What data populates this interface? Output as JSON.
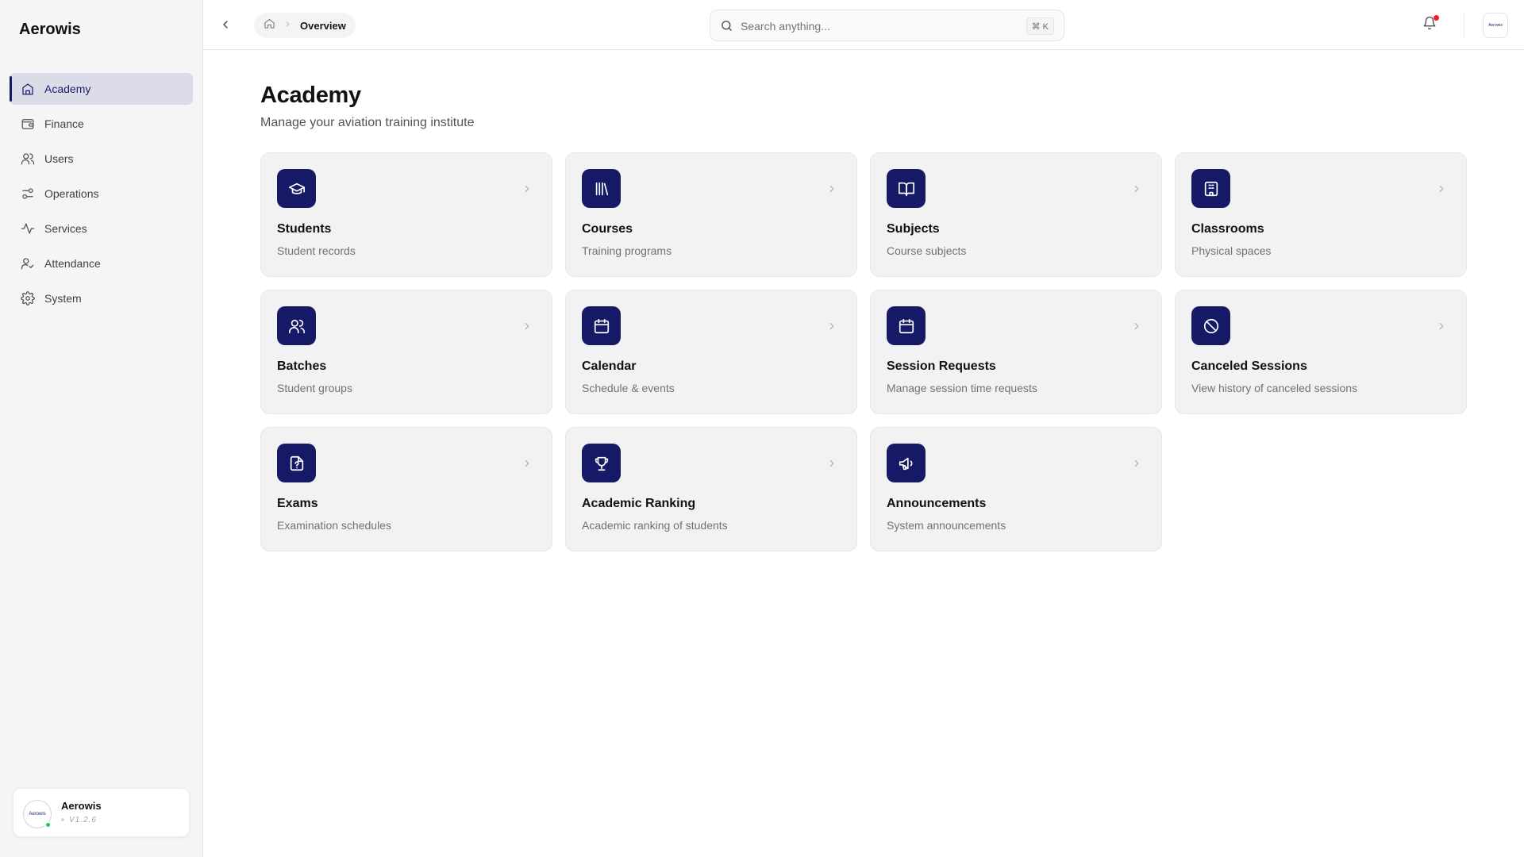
{
  "sidebar": {
    "brand": "Aerowis",
    "items": [
      {
        "label": "Academy",
        "icon": "academy-icon",
        "active": true
      },
      {
        "label": "Finance",
        "icon": "wallet-icon"
      },
      {
        "label": "Users",
        "icon": "users-icon"
      },
      {
        "label": "Operations",
        "icon": "sliders-icon"
      },
      {
        "label": "Services",
        "icon": "activity-icon"
      },
      {
        "label": "Attendance",
        "icon": "user-check-icon"
      },
      {
        "label": "System",
        "icon": "gear-icon"
      }
    ],
    "user": {
      "name": "Aerowis",
      "version": "V1.2.6",
      "avatar_text": "Aerowis",
      "status_color": "#22c55e"
    }
  },
  "header": {
    "breadcrumb": {
      "current": "Overview"
    },
    "search": {
      "placeholder": "Search anything...",
      "shortcut": "⌘ K"
    },
    "notification_badge_color": "#ef1c2b",
    "avatar_text": "Aerowis"
  },
  "main": {
    "title": "Academy",
    "subtitle": "Manage your aviation training institute",
    "cards": [
      {
        "title": "Students",
        "description": "Student records",
        "icon": "graduation-cap-icon"
      },
      {
        "title": "Courses",
        "description": "Training programs",
        "icon": "library-icon"
      },
      {
        "title": "Subjects",
        "description": "Course subjects",
        "icon": "book-open-icon"
      },
      {
        "title": "Classrooms",
        "description": "Physical spaces",
        "icon": "building-icon"
      },
      {
        "title": "Batches",
        "description": "Student groups",
        "icon": "users-icon"
      },
      {
        "title": "Calendar",
        "description": "Schedule & events",
        "icon": "calendar-icon"
      },
      {
        "title": "Session Requests",
        "description": "Manage session time requests",
        "icon": "calendar-icon"
      },
      {
        "title": "Canceled Sessions",
        "description": "View history of canceled sessions",
        "icon": "ban-icon"
      },
      {
        "title": "Exams",
        "description": "Examination schedules",
        "icon": "file-question-icon"
      },
      {
        "title": "Academic Ranking",
        "description": "Academic ranking of students",
        "icon": "trophy-icon"
      },
      {
        "title": "Announcements",
        "description": "System announcements",
        "icon": "megaphone-icon"
      }
    ]
  },
  "colors": {
    "accent": "#161a66",
    "sidebar_bg": "#f5f5f6",
    "card_bg": "#f2f2f3"
  }
}
